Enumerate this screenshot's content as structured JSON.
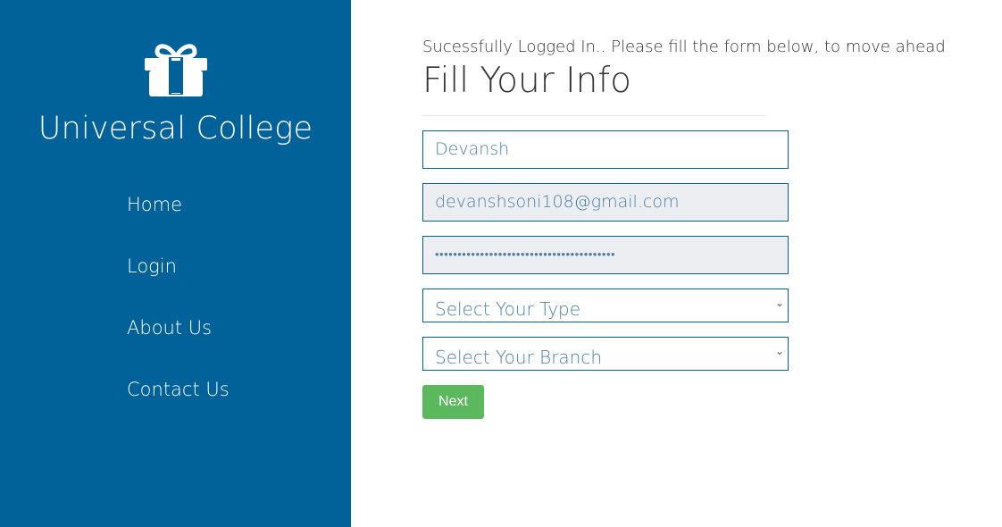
{
  "sidebar": {
    "brand": "Universal College",
    "logo_icon": "gift-icon",
    "nav": [
      {
        "label": "Home"
      },
      {
        "label": "Login"
      },
      {
        "label": "About Us"
      },
      {
        "label": "Contact Us"
      }
    ]
  },
  "main": {
    "message": "Sucessfully Logged In.. Please fill the form below, to move ahead",
    "title": "Fill Your Info",
    "name_value": "Devansh",
    "email_value": "devanshsoni108@gmail.com",
    "password_masked": "••••••••••••••••••••••••••••••••••••••••",
    "type_select": "Select Your Type",
    "branch_select": "Select Your Branch",
    "next_label": "Next"
  },
  "colors": {
    "sidebar": "#006298",
    "button": "#5cb85c"
  }
}
